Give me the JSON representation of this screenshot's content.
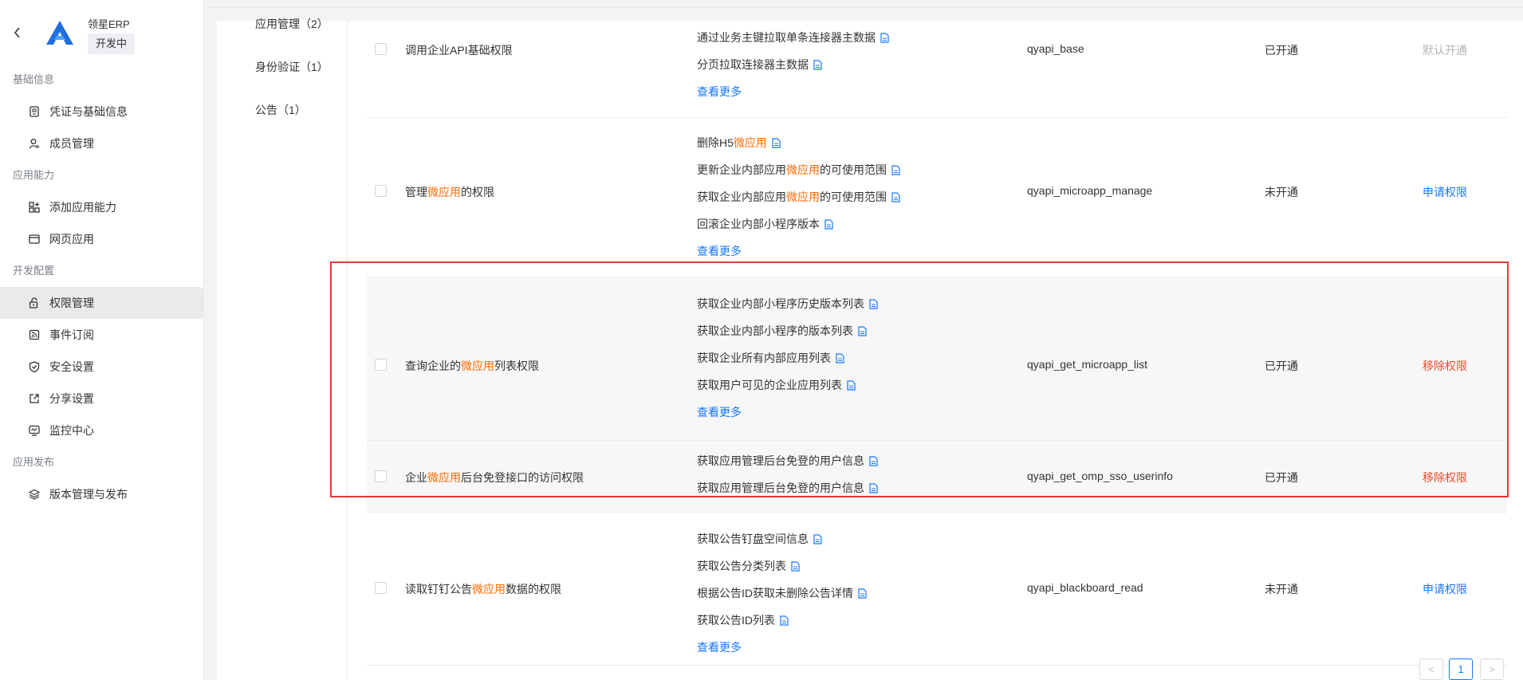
{
  "app": {
    "name": "领星ERP",
    "status": "开发中"
  },
  "sidebar": {
    "groups": [
      {
        "title": "基础信息",
        "items": [
          {
            "label": "凭证与基础信息",
            "icon": "credential-icon"
          },
          {
            "label": "成员管理",
            "icon": "member-icon"
          }
        ]
      },
      {
        "title": "应用能力",
        "items": [
          {
            "label": "添加应用能力",
            "icon": "add-ability-icon"
          },
          {
            "label": "网页应用",
            "icon": "web-app-icon"
          }
        ]
      },
      {
        "title": "开发配置",
        "items": [
          {
            "label": "权限管理",
            "icon": "permission-icon"
          },
          {
            "label": "事件订阅",
            "icon": "event-icon"
          },
          {
            "label": "安全设置",
            "icon": "shield-icon"
          },
          {
            "label": "分享设置",
            "icon": "share-icon"
          },
          {
            "label": "监控中心",
            "icon": "monitor-icon"
          }
        ]
      },
      {
        "title": "应用发布",
        "items": [
          {
            "label": "版本管理与发布",
            "icon": "layers-icon"
          }
        ]
      }
    ]
  },
  "categories": [
    "应用管理（2）",
    "身份验证（1）",
    "公告（1）"
  ],
  "rows": [
    {
      "name_pre": "调用企业API基础权限",
      "name_kw": "",
      "name_post": "",
      "apis": [
        "通过业务主键拉取单条连接器主数据",
        "分页拉取连接器主数据"
      ],
      "more": "查看更多",
      "code": "qyapi_base",
      "state": "已开通",
      "action": "默认开通"
    },
    {
      "name_pre": "管理",
      "name_kw": "微应用",
      "name_post": "的权限",
      "apis": [
        "删除H5微应用",
        "更新企业内部应用微应用的可使用范围",
        "获取企业内部应用微应用的可使用范围",
        "回滚企业内部小程序版本"
      ],
      "more": "查看更多",
      "code": "qyapi_microapp_manage",
      "state": "未开通",
      "action": "申请权限"
    },
    {
      "name_pre": "查询企业的",
      "name_kw": "微应用",
      "name_post": "列表权限",
      "apis": [
        "获取企业内部小程序历史版本列表",
        "获取企业内部小程序的版本列表",
        "获取企业所有内部应用列表",
        "获取用户可见的企业应用列表"
      ],
      "more": "查看更多",
      "code": "qyapi_get_microapp_list",
      "state": "已开通",
      "action": "移除权限"
    },
    {
      "name_pre": "企业",
      "name_kw": "微应用",
      "name_post": "后台免登接口的访问权限",
      "apis": [
        "获取应用管理后台免登的用户信息",
        "获取应用管理后台免登的用户信息"
      ],
      "more": "",
      "code": "qyapi_get_omp_sso_userinfo",
      "state": "已开通",
      "action": "移除权限"
    },
    {
      "name_pre": "读取钉钉公告",
      "name_kw": "微应用",
      "name_post": "数据的权限",
      "apis": [
        "获取公告钉盘空间信息",
        "获取公告分类列表",
        "根据公告ID获取未删除公告详情",
        "获取公告ID列表"
      ],
      "more": "查看更多",
      "code": "qyapi_blackboard_read",
      "state": "未开通",
      "action": "申请权限"
    }
  ],
  "pagination": {
    "prev": "<",
    "current": "1",
    "next": ">"
  },
  "colors": {
    "accent": "#1677ff",
    "keyword": "#ff6a00",
    "remove": "#f5462d",
    "highlight_border": "#e53935"
  }
}
